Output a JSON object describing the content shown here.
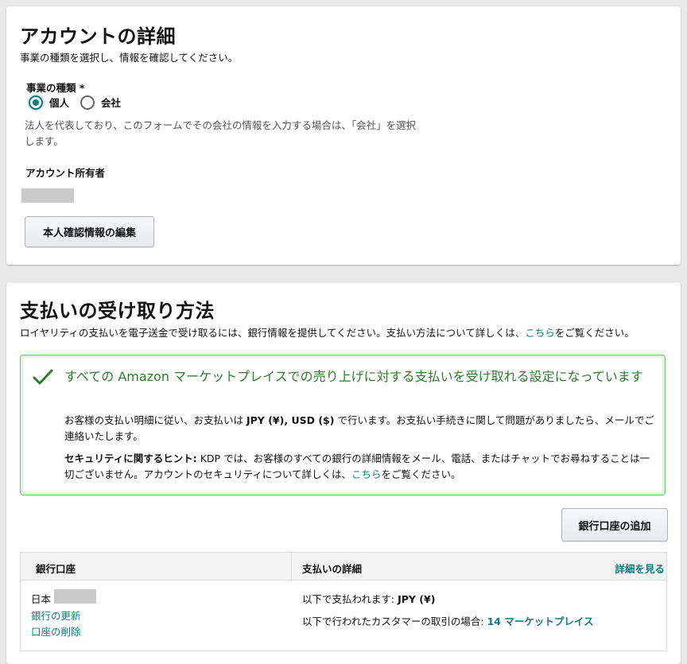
{
  "account": {
    "title": "アカウントの詳細",
    "subtitle": "事業の種類を選択し、情報を確認してください。",
    "business_type_label": "事業の種類 *",
    "option_individual": "個人",
    "option_company": "会社",
    "selected_option": "個人",
    "hint_line1": "法人を代表しており、このフォームでその会社の情報を入力する場合は、「会社」を選択",
    "hint_line2": "します。",
    "owner_label": "アカウント所有者",
    "edit_button": "本人確認情報の編集"
  },
  "payment": {
    "title": "支払いの受け取り方法",
    "description_prefix": "ロイヤリティの支払いを電子送金で受け取るには、銀行情報を提供してください。支払い方法について詳しくは、",
    "description_link": "こちら",
    "description_suffix": "をご覧ください。",
    "success_title": "すべての Amazon マーケットプレイスでの売り上げに対する支払いを受け取れる設定になっています",
    "success_body1_prefix": "お客様の支払い明細に従い、お支払いは",
    "success_body1_bold": "JPY (¥), USD ($)",
    "success_body1_suffix": "で行います。お支払い手続きに関して問題がありましたら、メールでご連絡いたします。",
    "success_body2_bold": "セキュリティに関するヒント:",
    "success_body2_text": "KDP では、お客様のすべての銀行の詳細情報をメール、電話、またはチャットでお尋ねすることは一切ございません。アカウントのセキュリティについて詳しくは、",
    "success_body2_link": "こちら",
    "success_body2_suffix": "をご覧ください。",
    "add_bank_button": "銀行口座の追加",
    "table": {
      "col_bank": "銀行口座",
      "col_details": "支払いの詳細",
      "view_details_link": "詳細を見る",
      "row": {
        "country": "日本",
        "update_link": "銀行の更新",
        "delete_link": "口座の削除",
        "paid_in_label": "以下で支払われます:",
        "paid_in_value": "JPY (¥)",
        "marketplace_label": "以下で行われたカスタマーの取引の場合:",
        "marketplace_link": "14 マーケットプレイス"
      }
    }
  },
  "colors": {
    "accent": "#127a82",
    "success": "#2c7d2c"
  }
}
